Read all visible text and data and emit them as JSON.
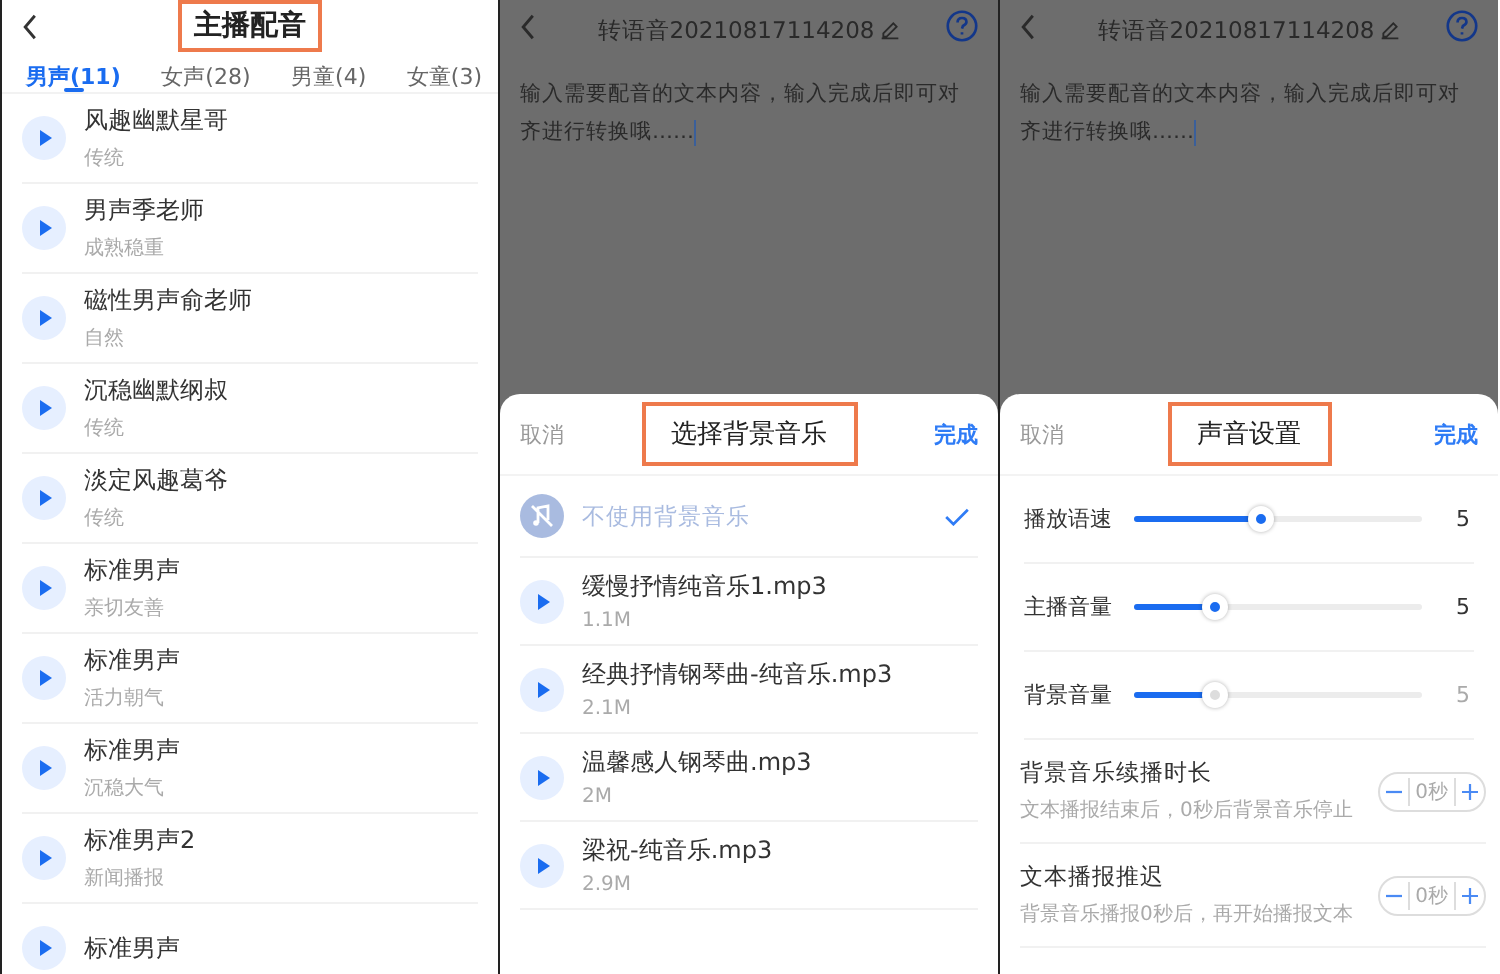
{
  "anchor_panel": {
    "title": "主播配音",
    "title_highlighted": true,
    "tabs": [
      {
        "label": "男声(11)",
        "selected": true
      },
      {
        "label": "女声(28)",
        "selected": false
      },
      {
        "label": "男童(4)",
        "selected": false
      },
      {
        "label": "女童(3)",
        "selected": false
      }
    ],
    "voices": [
      {
        "name": "风趣幽默星哥",
        "style": "传统"
      },
      {
        "name": "男声季老师",
        "style": "成熟稳重"
      },
      {
        "name": "磁性男声俞老师",
        "style": "自然"
      },
      {
        "name": "沉稳幽默纲叔",
        "style": "传统"
      },
      {
        "name": "淡定风趣葛爷",
        "style": "传统"
      },
      {
        "name": "标准男声",
        "style": "亲切友善"
      },
      {
        "name": "标准男声",
        "style": "活力朝气"
      },
      {
        "name": "标准男声",
        "style": "沉稳大气"
      },
      {
        "name": "标准男声2",
        "style": "新闻播报"
      },
      {
        "name": "标准男声"
      }
    ]
  },
  "music_panel": {
    "doc_title": "转语音20210817114208",
    "text": "输入需要配音的文本内容，输入完成后即可对齐进行转换哦……",
    "sheet": {
      "cancel": "取消",
      "title": "选择背景音乐",
      "title_highlighted": true,
      "done": "完成",
      "items": [
        {
          "kind": "none",
          "name": "不使用背景音乐",
          "selected": true
        },
        {
          "kind": "track",
          "name": "缓慢抒情纯音乐1.mp3",
          "size": "1.1M",
          "selected": false
        },
        {
          "kind": "track",
          "name": "经典抒情钢琴曲-纯音乐.mp3",
          "size": "2.1M",
          "selected": false
        },
        {
          "kind": "track",
          "name": "温馨感人钢琴曲.mp3",
          "size": "2M",
          "selected": false
        },
        {
          "kind": "track",
          "name": "梁祝-纯音乐.mp3",
          "size": "2.9M",
          "selected": false
        }
      ]
    }
  },
  "sound_panel": {
    "doc_title": "转语音20210817114208",
    "text": "输入需要配音的文本内容，输入完成后即可对齐进行转换哦……",
    "sheet": {
      "cancel": "取消",
      "title": "声音设置",
      "title_highlighted": true,
      "done": "完成",
      "rows": [
        {
          "kind": "slider",
          "label": "播放语速",
          "level": 0.44,
          "reading": "5",
          "disabled": false
        },
        {
          "kind": "slider",
          "label": "主播音量",
          "level": 0.28,
          "reading": "5",
          "disabled": false
        },
        {
          "kind": "slider",
          "label": "背景音量",
          "level": 0.28,
          "reading": "5",
          "disabled": true
        },
        {
          "kind": "stepper",
          "label": "背景音乐续播时长",
          "hint": "文本播报结束后，0秒后背景音乐停止",
          "value": "0秒"
        },
        {
          "kind": "stepper",
          "label": "文本播报推迟",
          "hint": "背景音乐播报0秒后，再开始播报文本",
          "value": "0秒"
        }
      ]
    }
  }
}
